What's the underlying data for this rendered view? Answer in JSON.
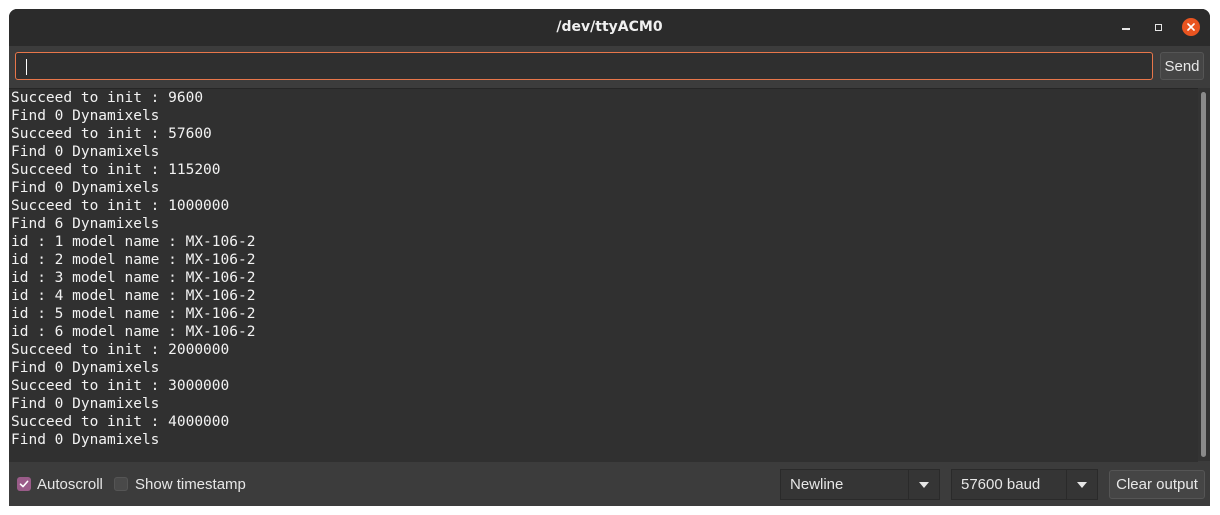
{
  "window": {
    "title": "/dev/ttyACM0"
  },
  "input": {
    "value": "",
    "send_label": "Send"
  },
  "output": {
    "lines": [
      "Succeed to init : 9600",
      "Find 0 Dynamixels",
      "Succeed to init : 57600",
      "Find 0 Dynamixels",
      "Succeed to init : 115200",
      "Find 0 Dynamixels",
      "Succeed to init : 1000000",
      "Find 6 Dynamixels",
      "id : 1 model name : MX-106-2",
      "id : 2 model name : MX-106-2",
      "id : 3 model name : MX-106-2",
      "id : 4 model name : MX-106-2",
      "id : 5 model name : MX-106-2",
      "id : 6 model name : MX-106-2",
      "Succeed to init : 2000000",
      "Find 0 Dynamixels",
      "Succeed to init : 3000000",
      "Find 0 Dynamixels",
      "Succeed to init : 4000000",
      "Find 0 Dynamixels"
    ]
  },
  "footer": {
    "autoscroll": {
      "label": "Autoscroll",
      "checked": true
    },
    "show_timestamp": {
      "label": "Show timestamp",
      "checked": false
    },
    "line_ending": {
      "selected": "Newline"
    },
    "baud_rate": {
      "selected": "57600 baud"
    },
    "clear_label": "Clear output"
  },
  "colors": {
    "accent_orange": "#e95420",
    "checkbox_checked": "#9a5c89",
    "input_border": "#e8764a"
  },
  "icons": {
    "minimize": "minimize-icon",
    "maximize": "maximize-icon",
    "close": "close-icon",
    "checkmark": "checkmark-icon",
    "dropdown": "chevron-down-icon"
  }
}
